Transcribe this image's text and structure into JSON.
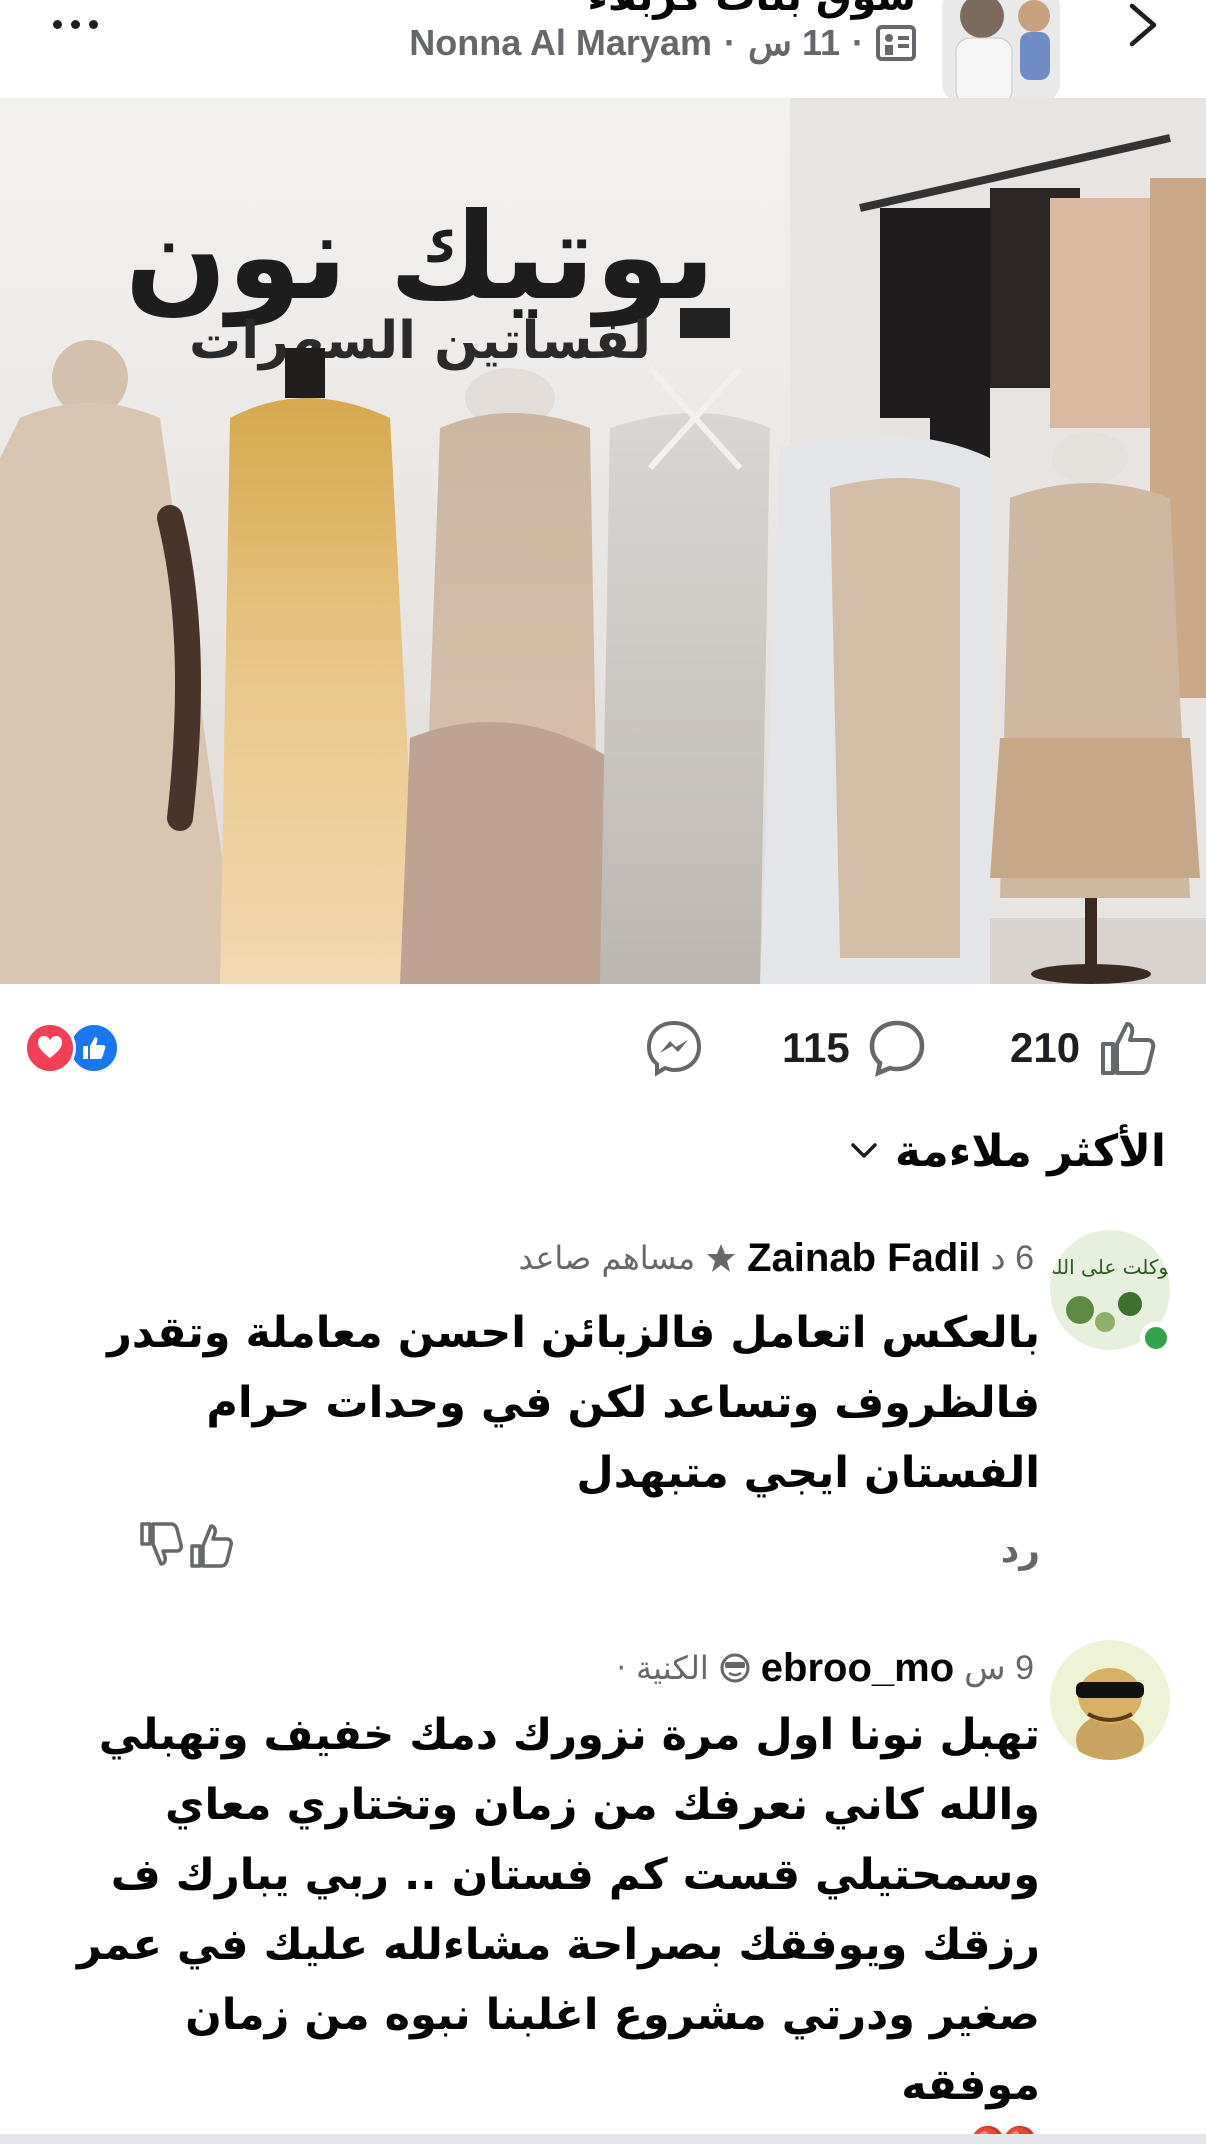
{
  "header": {
    "group_title": "سوق بنات كربلاء",
    "author": "Nonna Al Maryam",
    "time": "11 س",
    "meta_separator": "·"
  },
  "post_photo": {
    "sign_text": "بوتيك نون",
    "sign_subtext": "لفساتين السهرات"
  },
  "actions": {
    "likes": "210",
    "comments": "115"
  },
  "sort": {
    "label": "الأكثر ملاءمة"
  },
  "comments": [
    {
      "time": "6 د",
      "name": "Zainab Fadil",
      "badge": "مساهم صاعد",
      "text": "بالعكس اتعامل فالزبائن احسن معاملة وتقدر فالظروف وتساعد لكن في وحدات حرام الفستان ايجي متبهدل",
      "reply_label": "رد",
      "avatar_text": "توكلت على الله",
      "online": true
    },
    {
      "time": "9 س",
      "name": "ebroo_mo",
      "badge": "الكنية",
      "text": "تهبل نونا اول مرة نزورك دمك خفيف وتهبلي والله كاني نعرفك من زمان وتختاري معاي وسمحتيلي قست كم فستان .. ربي يبارك ف رزقك ويوفقك بصراحة مشاءلله عليك في عمر صغير ودرتي مشروع اغلبنا نبوه من زمان  موفقه",
      "emoji": "❤️"
    }
  ],
  "colors": {
    "secondary_text": "#65676b",
    "like_blue": "#1877f2",
    "love_red": "#f33e58",
    "online_green": "#31a24c"
  }
}
